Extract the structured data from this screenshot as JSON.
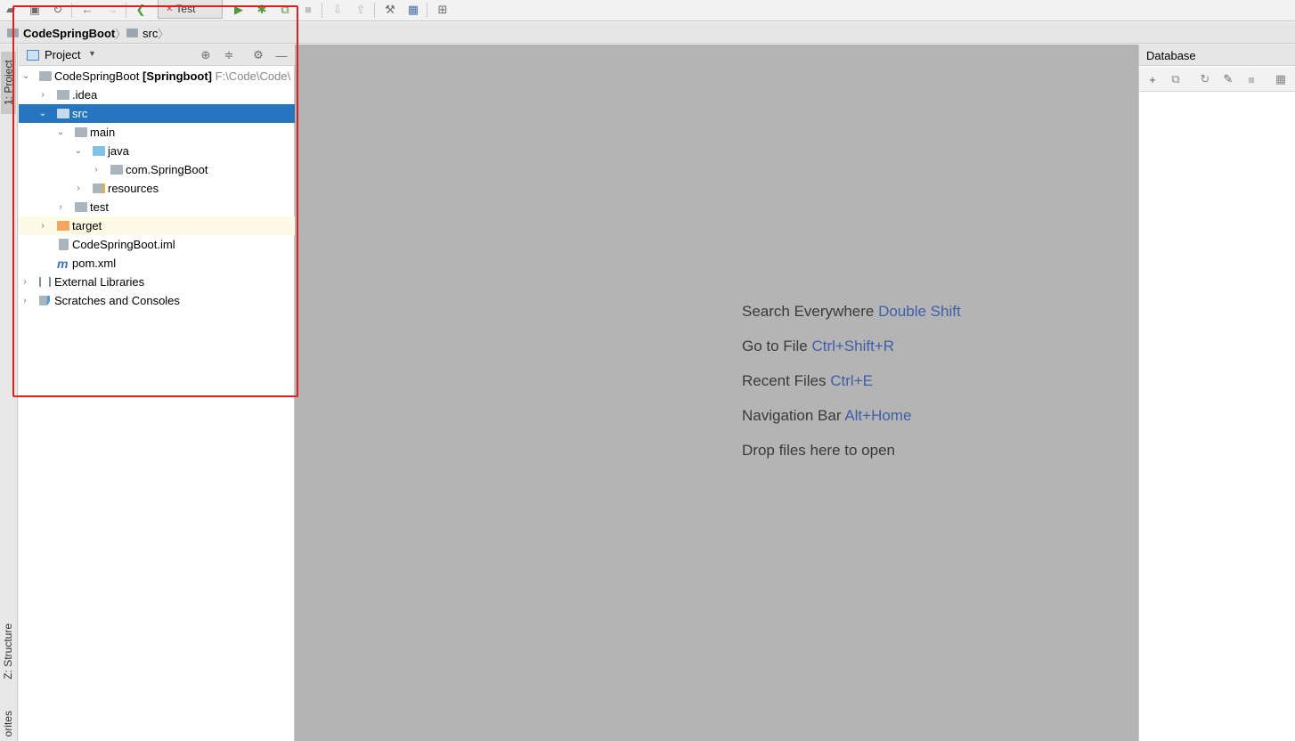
{
  "toolbar": {
    "run_config": "Test",
    "icons": [
      "open-icon",
      "save-icon",
      "sync-icon",
      "undo-icon",
      "redo-icon",
      "back-icon",
      "run-icon",
      "debug-icon",
      "coverage-icon",
      "stop-icon",
      "vcs-update-icon",
      "vcs-commit-icon",
      "settings-wrench-icon",
      "project-structure-icon",
      "sdk-icon"
    ]
  },
  "navbar": {
    "crumbs": [
      "CodeSpringBoot",
      "src"
    ]
  },
  "left_strip": {
    "project_tab": "1: Project",
    "structure_tab": "Z: Structure",
    "favorites_tab": "orites"
  },
  "project_panel": {
    "title": "Project",
    "tree": [
      {
        "label": "CodeSpringBoot",
        "module": "[Springboot]",
        "path": "F:\\Code\\Code\\",
        "expanded": true
      },
      {
        "label": ".idea",
        "expanded": false
      },
      {
        "label": "src",
        "expanded": true,
        "selected": true
      },
      {
        "label": "main",
        "expanded": true
      },
      {
        "label": "java",
        "expanded": true
      },
      {
        "label": "com.SpringBoot",
        "expanded": false
      },
      {
        "label": "resources",
        "expanded": false
      },
      {
        "label": "test",
        "expanded": false
      },
      {
        "label": "target",
        "expanded": false
      },
      {
        "label": "CodeSpringBoot.iml"
      },
      {
        "label": "pom.xml"
      },
      {
        "label": "External Libraries",
        "expanded": false
      },
      {
        "label": "Scratches and Consoles",
        "expanded": false
      }
    ]
  },
  "editor": {
    "hints": [
      {
        "text": "Search Everywhere",
        "key": "Double Shift"
      },
      {
        "text": "Go to File",
        "key": "Ctrl+Shift+R"
      },
      {
        "text": "Recent Files",
        "key": "Ctrl+E"
      },
      {
        "text": "Navigation Bar",
        "key": "Alt+Home"
      },
      {
        "text": "Drop files here to open",
        "key": ""
      }
    ]
  },
  "database_panel": {
    "title": "Database"
  },
  "colors": {
    "selection": "#2675bf",
    "editor_bg": "#b4b4b4",
    "hint_key": "#3e5fa8",
    "annotation": "#e02020"
  }
}
